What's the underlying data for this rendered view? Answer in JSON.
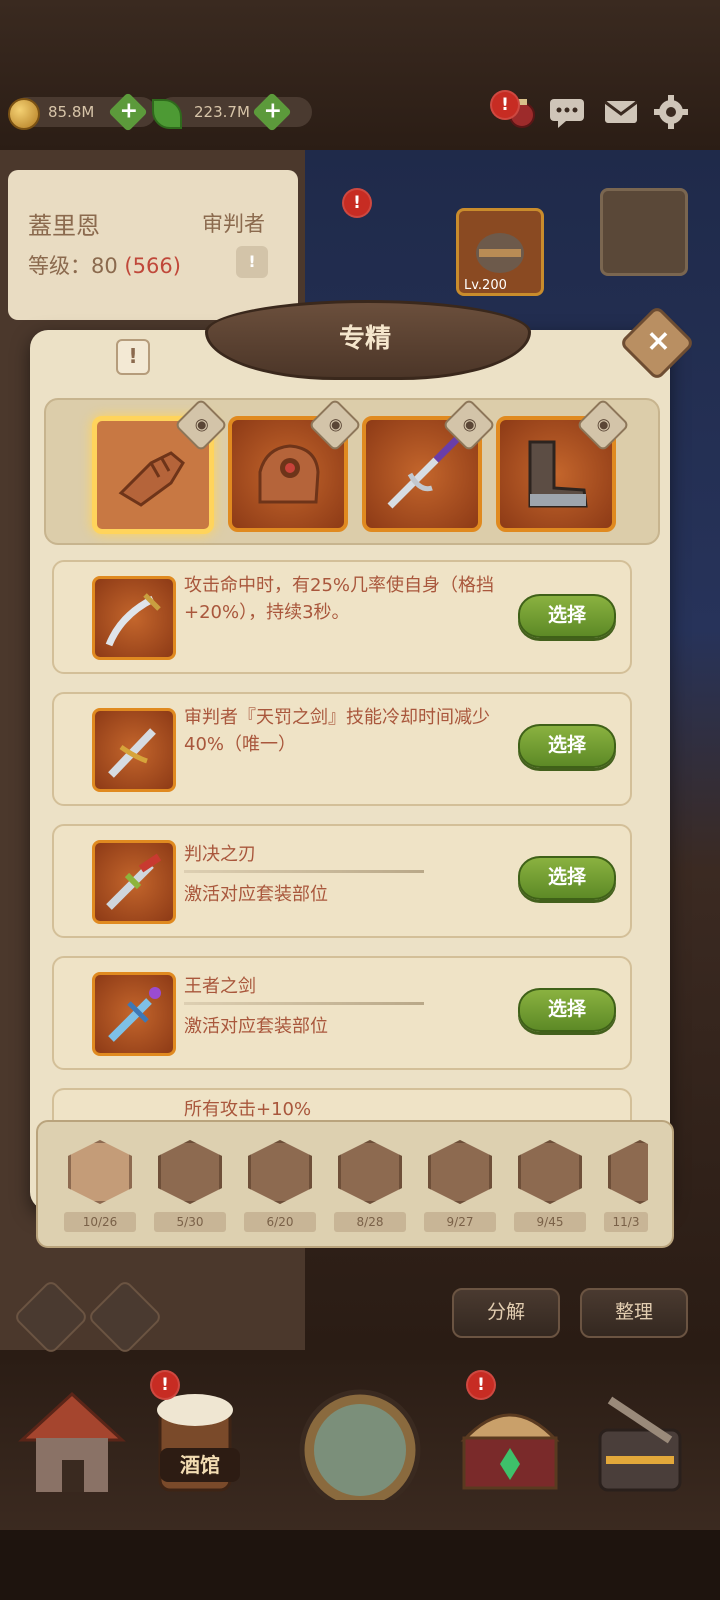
{
  "hud": {
    "gold": "85.8M",
    "gems": "223.7M",
    "icons": [
      "potion-icon",
      "chat-icon",
      "mail-icon",
      "gear-icon"
    ]
  },
  "hero": {
    "name": "蓋里恩",
    "class": "审判者",
    "level_label": "等级：",
    "level": "80",
    "power": "(566)",
    "equip_level": "Lv.200"
  },
  "dialog": {
    "title": "专精",
    "info_glyph": "!",
    "close_glyph": "×",
    "gear_slots": [
      {
        "name": "gauntlet",
        "selected": true
      },
      {
        "name": "glove-eye",
        "selected": false
      },
      {
        "name": "sword-purple",
        "selected": false
      },
      {
        "name": "boots",
        "selected": false
      }
    ],
    "options": [
      {
        "text": "攻击命中时，有25%几率使自身（格挡+20%），持续3秒。",
        "sub": "",
        "button": "选择"
      },
      {
        "text": "审判者『天罚之剑』技能冷却时间减少40%（唯一）",
        "sub": "",
        "button": "选择"
      },
      {
        "text": "判决之刃",
        "sub": "激活对应套装部位",
        "button": "选择"
      },
      {
        "text": "王者之剑",
        "sub": "激活对应套装部位",
        "button": "选择"
      },
      {
        "text": "所有攻击+10%",
        "sub": "",
        "button": ""
      }
    ]
  },
  "categories": [
    {
      "icon": "sword-icon",
      "count": "10/26"
    },
    {
      "icon": "drumstick-icon",
      "count": "5/30"
    },
    {
      "icon": "dagger-icon",
      "count": "6/20"
    },
    {
      "icon": "shield-icon",
      "count": "8/28"
    },
    {
      "icon": "book-icon",
      "count": "9/27"
    },
    {
      "icon": "helmet-icon",
      "count": "9/45"
    },
    {
      "icon": "ring-icon",
      "count": "11/3"
    }
  ],
  "bottom_buttons": {
    "decompose": "分解",
    "organize": "整理"
  },
  "nav": {
    "active_label": "酒馆",
    "items": [
      "house-icon",
      "tavern-icon",
      "portal-icon",
      "chest-icon",
      "forge-icon"
    ]
  },
  "colors": {
    "accent_orange": "#e08a20",
    "select_green": "#6c9a2c",
    "option_text": "#a9573c",
    "alert_red": "#c72c23"
  }
}
